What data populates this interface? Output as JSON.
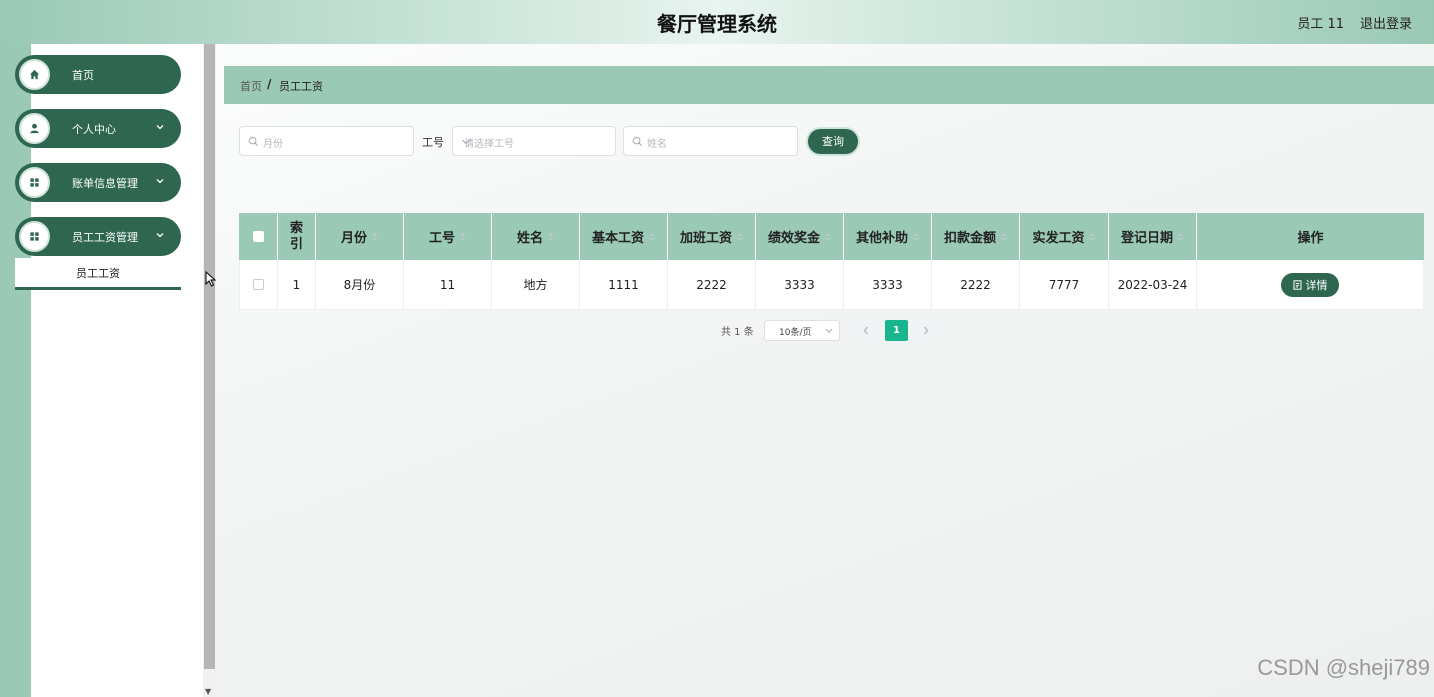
{
  "header": {
    "title": "餐厅管理系统",
    "user": "员工 11",
    "logout": "退出登录"
  },
  "sidebar": {
    "items": [
      {
        "label": "首页",
        "icon": "home-icon"
      },
      {
        "label": "个人中心",
        "icon": "user-icon"
      },
      {
        "label": "账单信息管理",
        "icon": "grid-icon"
      },
      {
        "label": "员工工资管理",
        "icon": "grid-icon"
      }
    ],
    "submenu_label": "员工工资"
  },
  "breadcrumb": {
    "home": "首页",
    "separator": "/",
    "current": "员工工资"
  },
  "search": {
    "month_placeholder": "月份",
    "gonghao_label": "工号",
    "gonghao_placeholder": "请选择工号",
    "name_placeholder": "姓名",
    "query_button": "查询"
  },
  "table": {
    "headers": [
      "索引",
      "月份",
      "工号",
      "姓名",
      "基本工资",
      "加班工资",
      "绩效奖金",
      "其他补助",
      "扣款金额",
      "实发工资",
      "登记日期",
      "操作"
    ],
    "rows": [
      {
        "index": "1",
        "month": "8月份",
        "gonghao": "11",
        "name": "地方",
        "base": "1111",
        "overtime": "2222",
        "bonus": "3333",
        "subsidy": "3333",
        "deduction": "2222",
        "actual": "7777",
        "date": "2022-03-24",
        "action": "详情"
      }
    ]
  },
  "pagination": {
    "total": "共 1 条",
    "page_size": "10条/页",
    "current_page": "1"
  },
  "watermark": "CSDN @sheji789",
  "colors": {
    "primary_dark": "#2e6650",
    "primary_light": "#9ac9b6",
    "active_page": "#18b58f"
  }
}
